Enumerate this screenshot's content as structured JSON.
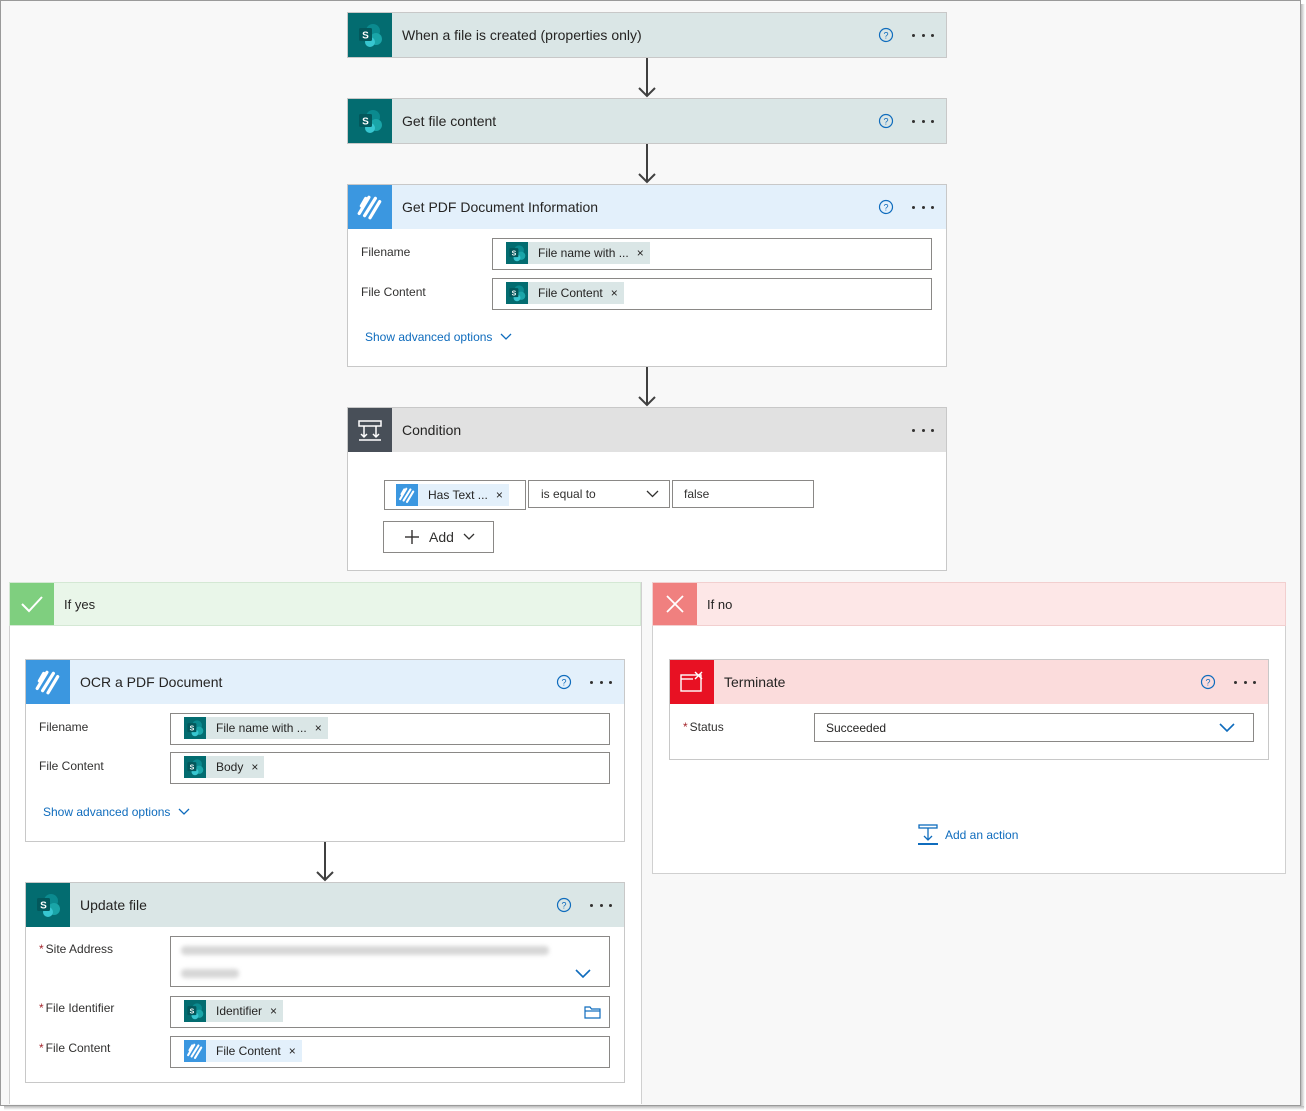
{
  "trigger": {
    "title": "When a file is created (properties only)"
  },
  "get_content": {
    "title": "Get file content"
  },
  "pdf_info": {
    "title": "Get PDF Document Information",
    "filename_label": "Filename",
    "filename_token": "File name with ...",
    "filecontent_label": "File Content",
    "filecontent_token": "File Content",
    "advanced": "Show advanced options"
  },
  "condition": {
    "title": "Condition",
    "left_token": "Has Text ...",
    "operator": "is equal to",
    "value": "false",
    "add_label": "Add"
  },
  "if_yes": {
    "title": "If yes",
    "ocr": {
      "title": "OCR a PDF Document",
      "filename_label": "Filename",
      "filename_token": "File name with ...",
      "filecontent_label": "File Content",
      "filecontent_token": "Body",
      "advanced": "Show advanced options"
    },
    "update": {
      "title": "Update file",
      "site_label": "Site Address",
      "identifier_label": "File Identifier",
      "identifier_token": "Identifier",
      "filecontent_label": "File Content",
      "filecontent_token": "File Content"
    }
  },
  "if_no": {
    "title": "If no",
    "terminate": {
      "title": "Terminate",
      "status_label": "Status",
      "status_value": "Succeeded"
    },
    "add_action": "Add an action"
  },
  "required_mark": "*",
  "remove_glyph": "×",
  "colors": {
    "sharepoint": "#036c70",
    "pdf": "#3b97e0",
    "condition": "#484f58",
    "terminate": "#e81123",
    "link": "#0f6cbd",
    "yes": "#7fcf7f",
    "no": "#f0807f"
  }
}
